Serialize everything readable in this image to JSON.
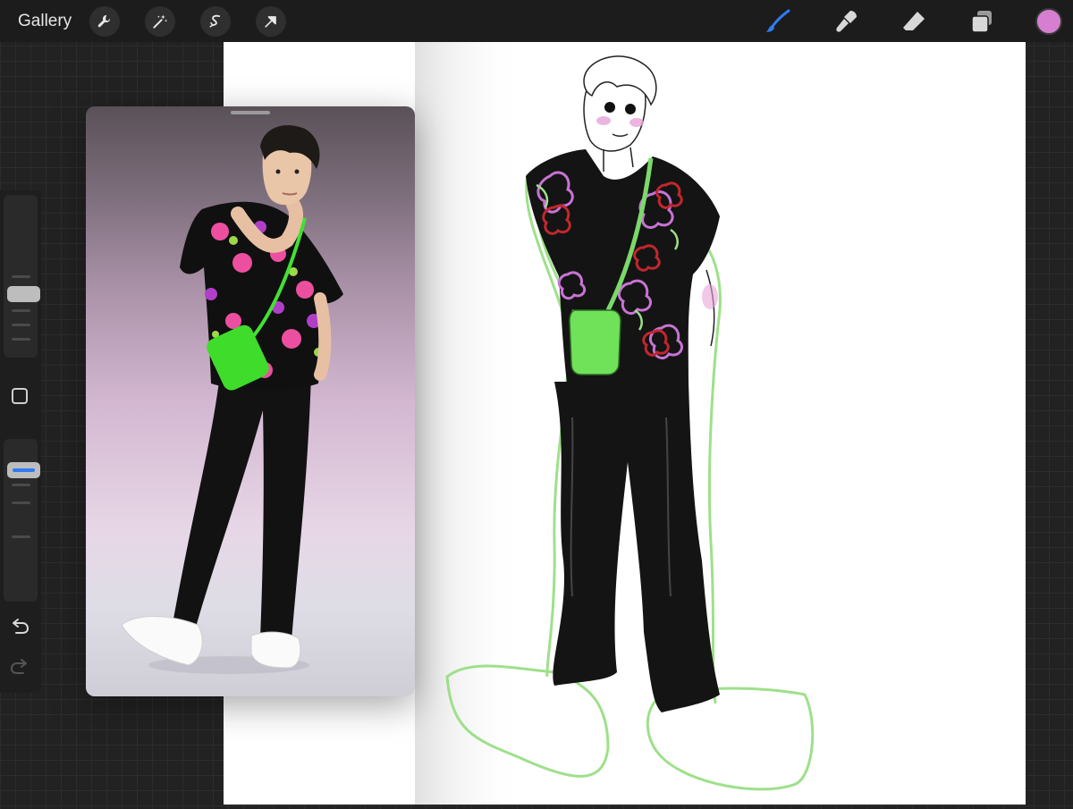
{
  "topbar": {
    "gallery_label": "Gallery",
    "tools_left": [
      "wrench-icon",
      "magic-wand-icon",
      "selection-icon",
      "transform-arrow-icon"
    ],
    "tools_right": [
      "brush-icon",
      "smudge-icon",
      "eraser-icon",
      "layers-icon"
    ],
    "active_tool": "brush-icon",
    "current_color": "#d67fd0",
    "brush_accent": "#2f7bf5"
  },
  "sidebar": {
    "brush_size_level": 0.55,
    "opacity_level": 0.8,
    "opacity_accent": "#2f7bf5",
    "buttons": [
      "modify-button",
      "undo-icon",
      "redo-icon"
    ]
  }
}
